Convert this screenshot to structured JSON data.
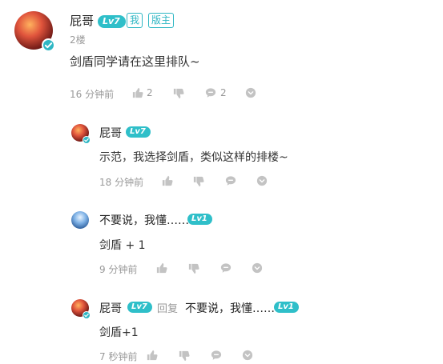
{
  "colors": {
    "accent": "#2fb7c4",
    "muted": "#999999",
    "text": "#333333"
  },
  "main": {
    "author": "屁哥",
    "level": "Lv7",
    "tags": [
      "我",
      "版主"
    ],
    "floor": "2楼",
    "content": "剑盾同学请在这里排队~",
    "time": "16 分钟前",
    "likes": "2",
    "comments": "2"
  },
  "replies": [
    {
      "author": "屁哥",
      "level": "Lv7",
      "content": "示范，我选择剑盾，类似这样的排楼~",
      "time": "18 分钟前"
    },
    {
      "author": "不要说，我懂……",
      "level": "Lv1",
      "content": "剑盾 + 1",
      "time": "9 分钟前"
    },
    {
      "author": "屁哥",
      "level": "Lv7",
      "reply_word": "回复",
      "reply_to": "不要说，我懂……",
      "reply_to_level": "Lv1",
      "content": "剑盾+1",
      "time": "7 秒钟前"
    }
  ],
  "icons": [
    "verified-icon",
    "thumbs-up-icon",
    "thumbs-down-icon",
    "comment-icon",
    "more-icon"
  ]
}
